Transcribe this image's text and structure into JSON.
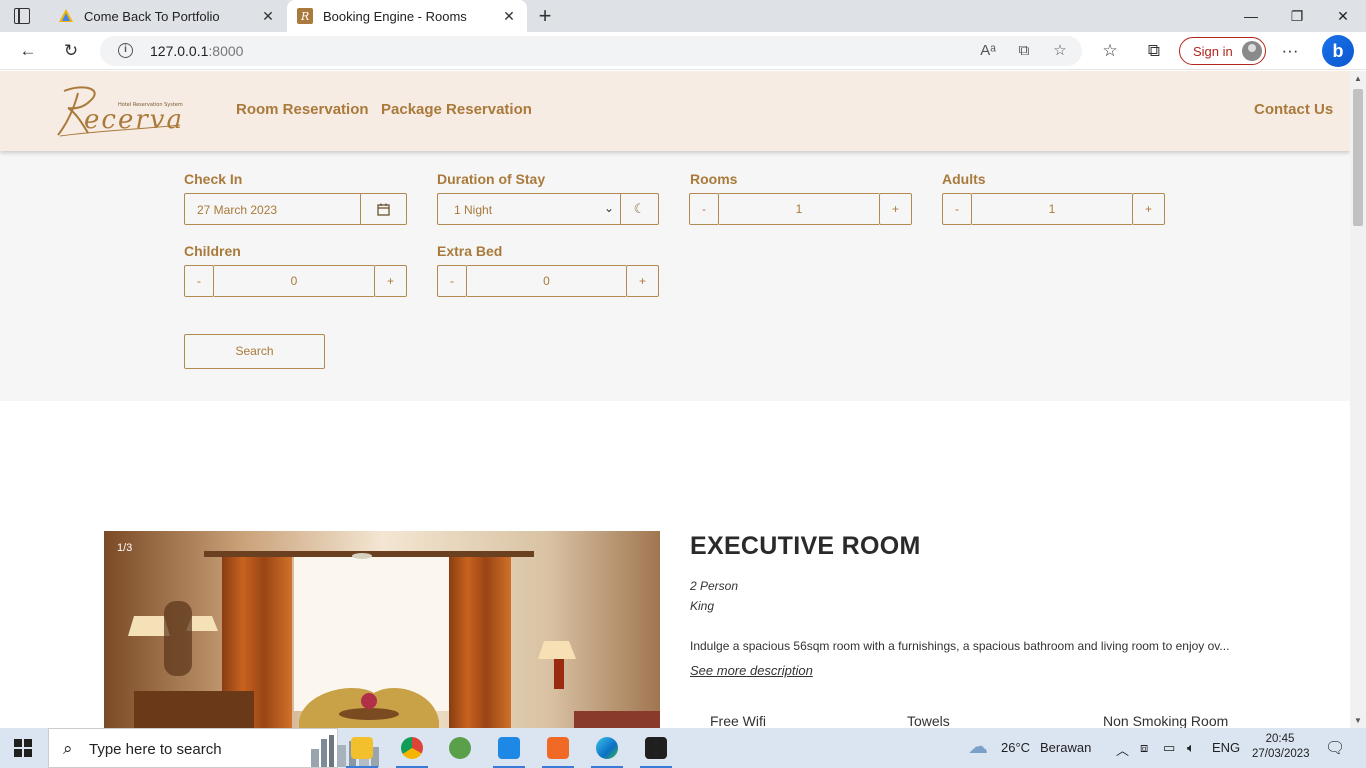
{
  "browser": {
    "tabs": [
      {
        "title": "Come Back To Portfolio",
        "active": false
      },
      {
        "title": "Booking Engine - Rooms",
        "active": true
      }
    ],
    "url_host": "127.0.0.1",
    "url_port": ":8000",
    "signin_label": "Sign in",
    "accent_color": "#b3261e"
  },
  "site": {
    "logo_text": "Recerva",
    "logo_tagline": "Hotel Reservation System",
    "nav": [
      {
        "label": "Room Reservation"
      },
      {
        "label": "Package Reservation"
      }
    ],
    "contact_label": "Contact Us",
    "brand_color": "#a97a3b",
    "header_bg": "#f7ece3"
  },
  "search": {
    "check_in": {
      "label": "Check In",
      "value": "27 March 2023",
      "icon": "calendar-icon"
    },
    "duration": {
      "label": "Duration of Stay",
      "value": "1 Night",
      "icon": "moon-icon"
    },
    "rooms": {
      "label": "Rooms",
      "value": "1"
    },
    "adults": {
      "label": "Adults",
      "value": "1"
    },
    "children": {
      "label": "Children",
      "value": "0"
    },
    "extra_bed": {
      "label": "Extra Bed",
      "value": "0"
    },
    "minus": "-",
    "plus": "+",
    "button_label": "Search"
  },
  "room": {
    "photo_counter": "1/3",
    "title": "EXECUTIVE ROOM",
    "capacity": "2 Person",
    "bed": "King",
    "description": "Indulge a spacious 56sqm room with a furnishings, a spacious bathroom and living room to enjoy ov...",
    "see_more": "See more description",
    "amenities": [
      "Free Wifi",
      "Towels",
      "Non Smoking Room"
    ]
  },
  "taskbar": {
    "search_placeholder": "Type here to search",
    "weather_temp": "26°C",
    "weather_text": "Berawan",
    "language": "ENG",
    "time": "20:45",
    "date": "27/03/2023"
  }
}
